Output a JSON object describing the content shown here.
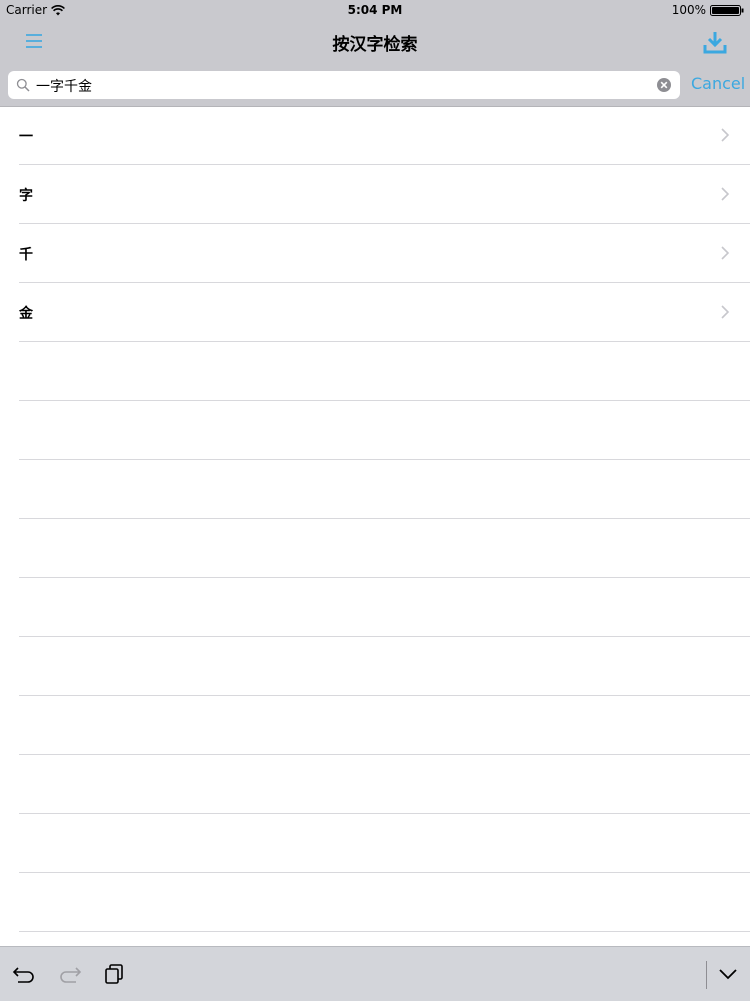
{
  "status_bar": {
    "carrier": "Carrier",
    "time": "5:04 PM",
    "battery": "100%"
  },
  "nav": {
    "title": "按汉字检索",
    "menu_icon": "hamburger-menu-icon",
    "download_icon": "download-icon"
  },
  "search": {
    "query": "一字千金",
    "cancel_label": "Cancel"
  },
  "results": [
    {
      "label": "一"
    },
    {
      "label": "字"
    },
    {
      "label": "千"
    },
    {
      "label": "金"
    }
  ],
  "colors": {
    "accent": "#3ba8e0",
    "bar_bg": "#c9c9ce",
    "separator": "#d8d8dc",
    "keyboard_bar": "#d3d5da"
  },
  "keyboard_bar": {
    "icons": [
      "undo-icon",
      "redo-icon",
      "paste-icon",
      "dismiss-keyboard-icon"
    ]
  }
}
